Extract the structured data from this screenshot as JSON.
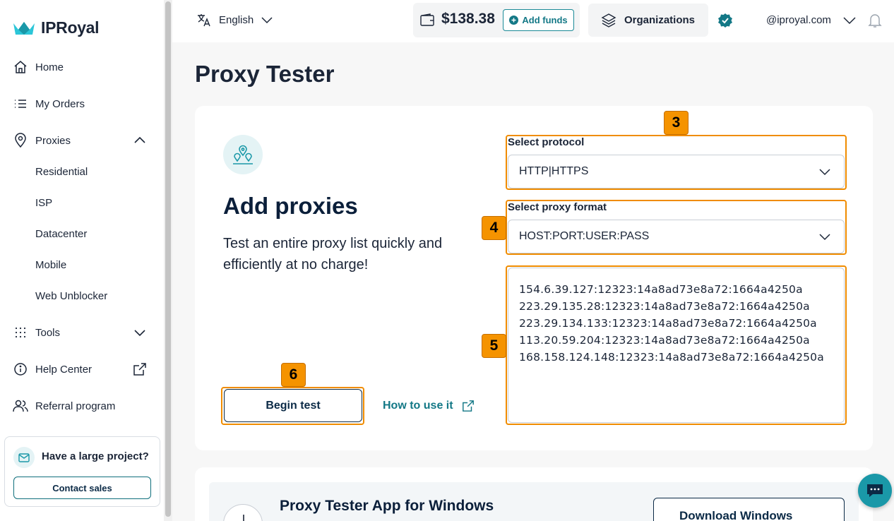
{
  "brand": {
    "name": "IPRoyal",
    "accent": "#137886"
  },
  "sidebar": {
    "items": [
      {
        "label": "Home",
        "icon": "home-icon"
      },
      {
        "label": "My Orders",
        "icon": "list-icon"
      },
      {
        "label": "Proxies",
        "icon": "location-pin-icon",
        "expanded": true
      },
      {
        "label": "Tools",
        "icon": "grid-dots-icon",
        "expanded": false
      },
      {
        "label": "Help Center",
        "icon": "info-icon"
      },
      {
        "label": "Referral program",
        "icon": "users-icon"
      }
    ],
    "proxy_subitems": [
      "Residential",
      "ISP",
      "Datacenter",
      "Mobile",
      "Web Unblocker"
    ],
    "promo": {
      "title": "Have a large project?",
      "button": "Contact sales"
    }
  },
  "topbar": {
    "language": "English",
    "balance": "$138.38",
    "add_funds": "Add funds",
    "organizations": "Organizations",
    "email": "@iproyal.com"
  },
  "page": {
    "title": "Proxy Tester",
    "card": {
      "title": "Add proxies",
      "description": "Test an entire proxy list quickly and efficiently at no charge!",
      "protocol_label": "Select protocol",
      "protocol_value": "HTTP|HTTPS",
      "format_label": "Select proxy format",
      "format_value": "HOST:PORT:USER:PASS",
      "proxy_list": [
        "154.6.39.127:12323:14a8ad73e8a72:1664a4250a",
        "223.29.135.28:12323:14a8ad73e8a72:1664a4250a",
        "223.29.134.133:12323:14a8ad73e8a72:1664a4250a",
        "113.20.59.204:12323:14a8ad73e8a72:1664a4250a",
        "168.158.124.148:12323:14a8ad73e8a72:1664a4250a"
      ],
      "begin_test": "Begin test",
      "how_to": "How to use it"
    },
    "app_card": {
      "title": "Proxy Tester App for Windows",
      "download": "Download Windows"
    }
  },
  "annotations": {
    "badge_3": "3",
    "badge_4": "4",
    "badge_5": "5",
    "badge_6": "6",
    "color": "#f08c00"
  }
}
